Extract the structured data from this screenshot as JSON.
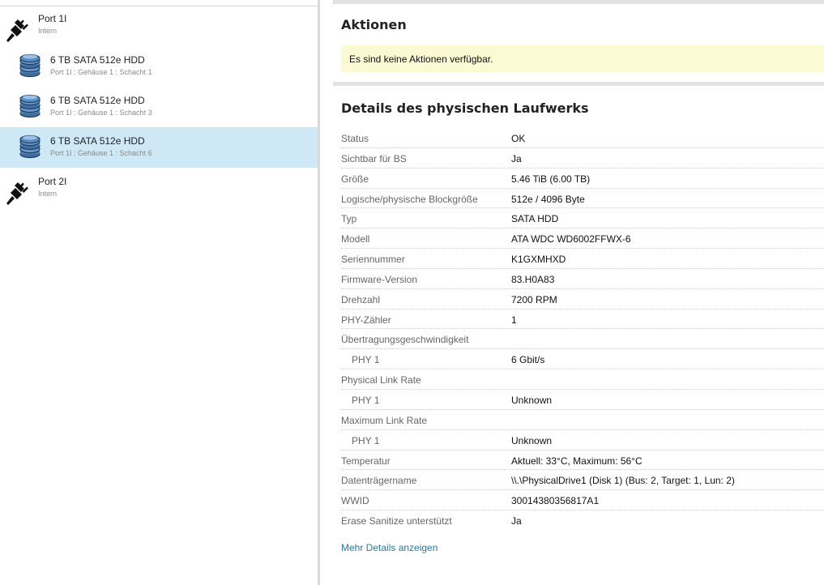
{
  "tree": {
    "nodes": [
      {
        "kind": "port",
        "name": "Port 1I",
        "sub": "Intern",
        "selected": false
      },
      {
        "kind": "drive",
        "name": "6 TB SATA 512e HDD",
        "sub": "Port 1I : Gehäuse 1 : Schacht 1",
        "selected": false
      },
      {
        "kind": "drive",
        "name": "6 TB SATA 512e HDD",
        "sub": "Port 1I : Gehäuse 1 : Schacht 3",
        "selected": false
      },
      {
        "kind": "drive",
        "name": "6 TB SATA 512e HDD",
        "sub": "Port 1I : Gehäuse 1 : Schacht 6",
        "selected": true
      },
      {
        "kind": "port",
        "name": "Port 2I",
        "sub": "Intern",
        "selected": false
      }
    ]
  },
  "actions": {
    "title": "Aktionen",
    "message": "Es sind keine Aktionen verfügbar."
  },
  "details": {
    "title": "Details des physischen Laufwerks",
    "rows": [
      {
        "label": "Status",
        "value": "OK",
        "sub": false
      },
      {
        "label": "Sichtbar für BS",
        "value": "Ja",
        "sub": false
      },
      {
        "label": "Größe",
        "value": "5.46 TiB (6.00 TB)",
        "sub": false
      },
      {
        "label": "Logische/physische Blockgröße",
        "value": "512e / 4096 Byte",
        "sub": false
      },
      {
        "label": "Typ",
        "value": "SATA HDD",
        "sub": false
      },
      {
        "label": "Modell",
        "value": "ATA WDC WD6002FFWX-6",
        "sub": false
      },
      {
        "label": "Seriennummer",
        "value": "K1GXMHXD",
        "sub": false
      },
      {
        "label": "Firmware-Version",
        "value": "83.H0A83",
        "sub": false
      },
      {
        "label": "Drehzahl",
        "value": "7200 RPM",
        "sub": false
      },
      {
        "label": "PHY-Zähler",
        "value": "1",
        "sub": false
      },
      {
        "label": "Übertragungsgeschwindigkeit",
        "value": "",
        "sub": false
      },
      {
        "label": "PHY 1",
        "value": "6 Gbit/s",
        "sub": true
      },
      {
        "label": "Physical Link Rate",
        "value": "",
        "sub": false
      },
      {
        "label": "PHY 1",
        "value": "Unknown",
        "sub": true
      },
      {
        "label": "Maximum Link Rate",
        "value": "",
        "sub": false
      },
      {
        "label": "PHY 1",
        "value": "Unknown",
        "sub": true
      },
      {
        "label": "Temperatur",
        "value": "Aktuell: 33°C, Maximum: 56°C",
        "sub": false
      },
      {
        "label": "Datenträgername",
        "value": "\\\\.\\PhysicalDrive1 (Disk 1) (Bus: 2, Target: 1, Lun: 2)",
        "sub": false
      },
      {
        "label": "WWID",
        "value": "30014380356817A1",
        "sub": false
      },
      {
        "label": "Erase Sanitize unterstützt",
        "value": "Ja",
        "sub": false
      }
    ],
    "more_link": "Mehr Details anzeigen"
  },
  "colors": {
    "selected_row": "#cfe8f5",
    "notice_bg": "#fcfad2",
    "link": "#2a78a8",
    "disk_blue": "#4a7fb5"
  }
}
